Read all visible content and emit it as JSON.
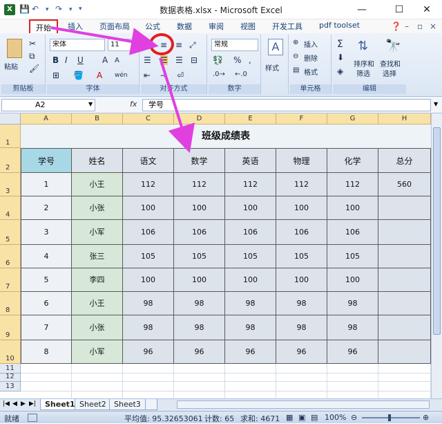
{
  "window": {
    "title": "数据表格.xlsx - Microsoft Excel",
    "minimize": "—",
    "maximize": "☐",
    "close": "✕"
  },
  "tabs": [
    "开始",
    "插入",
    "页面布局",
    "公式",
    "数据",
    "审阅",
    "视图",
    "开发工具",
    "pdf toolset"
  ],
  "ribbon": {
    "paste_label": "粘贴",
    "font_name": "宋体",
    "font_size": "11",
    "bold": "B",
    "italic": "I",
    "underline": "U",
    "grow_font": "A",
    "shrink_font": "A",
    "wen": "wén",
    "number_format": "常规",
    "percent": "%",
    "comma": ",",
    "style_label": "样式",
    "insert_label": "插入",
    "delete_label": "删除",
    "format_label": "格式",
    "sigma": "Σ",
    "sort_filter_label_1": "排序和",
    "sort_filter_label_2": "筛选",
    "find_select_label_1": "查找和",
    "find_select_label_2": "选择",
    "groups": [
      "剪贴板",
      "字体",
      "对齐方式",
      "数字",
      "单元格",
      "编辑"
    ]
  },
  "formula_bar": {
    "name_box": "A2",
    "fx": "fx",
    "content": "学号"
  },
  "sheet": {
    "columns": [
      "A",
      "B",
      "C",
      "D",
      "E",
      "F",
      "G",
      "H"
    ],
    "rows": [
      "1",
      "2",
      "3",
      "4",
      "5",
      "6",
      "7",
      "8",
      "9",
      "10",
      "11",
      "12",
      "13"
    ],
    "title": "班级成绩表",
    "headers": [
      "学号",
      "姓名",
      "语文",
      "数学",
      "英语",
      "物理",
      "化学",
      "总分"
    ],
    "data": [
      [
        "1",
        "小王",
        "112",
        "112",
        "112",
        "112",
        "112",
        "560"
      ],
      [
        "2",
        "小张",
        "100",
        "100",
        "100",
        "100",
        "100",
        ""
      ],
      [
        "3",
        "小军",
        "106",
        "106",
        "106",
        "106",
        "106",
        ""
      ],
      [
        "4",
        "张三",
        "105",
        "105",
        "105",
        "105",
        "105",
        ""
      ],
      [
        "5",
        "李四",
        "100",
        "100",
        "100",
        "100",
        "100",
        ""
      ],
      [
        "6",
        "小王",
        "98",
        "98",
        "98",
        "98",
        "98",
        ""
      ],
      [
        "7",
        "小张",
        "98",
        "98",
        "98",
        "98",
        "98",
        ""
      ],
      [
        "8",
        "小军",
        "96",
        "96",
        "96",
        "96",
        "96",
        ""
      ]
    ]
  },
  "sheet_tabs": [
    "Sheet1",
    "Sheet2",
    "Sheet3"
  ],
  "status": {
    "ready": "就绪",
    "average": "平均值: 95.32653061",
    "count": "计数: 65",
    "sum": "求和: 4671",
    "zoom": "100%"
  },
  "colors": {
    "accent": "#e02020",
    "arrow": "#e040e0",
    "header_fill": "#a8d8e6",
    "name_fill": "#d8e8d8",
    "data_fill": "#dde3ea"
  }
}
